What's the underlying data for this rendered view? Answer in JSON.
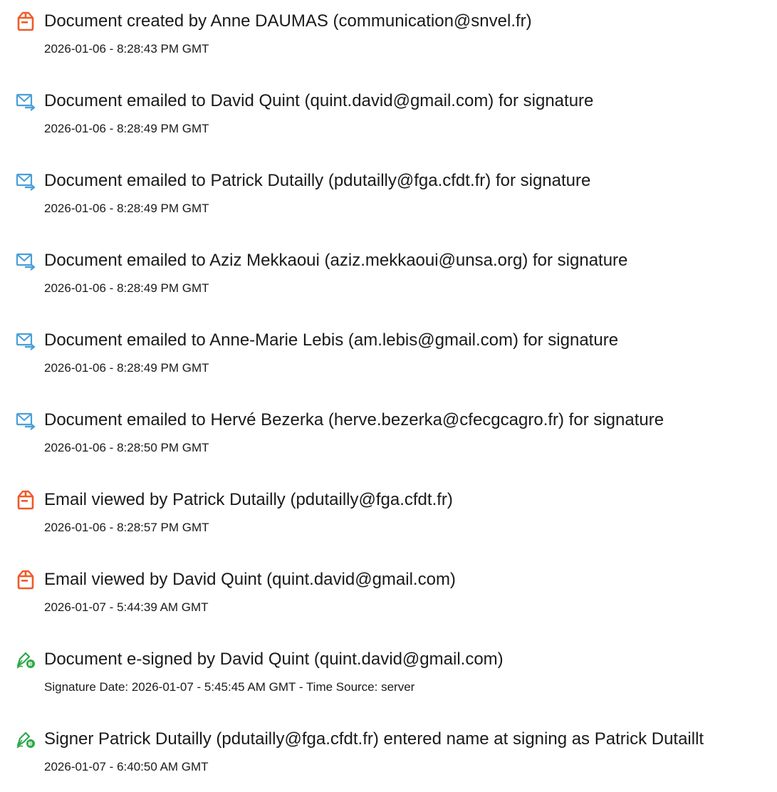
{
  "audit_log": {
    "entries": [
      {
        "icon": "document-created-icon",
        "title": "Document created by Anne DAUMAS (communication@snvel.fr)",
        "subtitle": "2026-01-06 - 8:28:43 PM GMT"
      },
      {
        "icon": "email-sent-icon",
        "title": "Document emailed to David Quint (quint.david@gmail.com) for signature",
        "subtitle": "2026-01-06 - 8:28:49 PM GMT"
      },
      {
        "icon": "email-sent-icon",
        "title": "Document emailed to Patrick Dutailly (pdutailly@fga.cfdt.fr) for signature",
        "subtitle": "2026-01-06 - 8:28:49 PM GMT"
      },
      {
        "icon": "email-sent-icon",
        "title": "Document emailed to Aziz Mekkaoui (aziz.mekkaoui@unsa.org) for signature",
        "subtitle": "2026-01-06 - 8:28:49 PM GMT"
      },
      {
        "icon": "email-sent-icon",
        "title": "Document emailed to Anne-Marie Lebis (am.lebis@gmail.com) for signature",
        "subtitle": "2026-01-06 - 8:28:49 PM GMT"
      },
      {
        "icon": "email-sent-icon",
        "title": "Document emailed to Hervé Bezerka (herve.bezerka@cfecgcagro.fr) for signature",
        "subtitle": "2026-01-06 - 8:28:50 PM GMT"
      },
      {
        "icon": "email-viewed-icon",
        "title": "Email viewed by Patrick Dutailly (pdutailly@fga.cfdt.fr)",
        "subtitle": "2026-01-06 - 8:28:57 PM GMT"
      },
      {
        "icon": "email-viewed-icon",
        "title": "Email viewed by David Quint (quint.david@gmail.com)",
        "subtitle": "2026-01-07 - 5:44:39 AM GMT"
      },
      {
        "icon": "e-signed-icon",
        "title": "Document e-signed by David Quint (quint.david@gmail.com)",
        "subtitle": "Signature Date: 2026-01-07 - 5:45:45 AM GMT - Time Source: server"
      },
      {
        "icon": "e-signed-icon",
        "title": "Signer Patrick Dutailly (pdutailly@fga.cfdt.fr) entered name at signing as Patrick Dutaillt",
        "subtitle": "2026-01-07 - 6:40:50 AM GMT"
      }
    ]
  },
  "colors": {
    "document_icon": "#f05a28",
    "email_icon": "#4a9fd8",
    "sign_icon": "#2ea84a",
    "text": "#1a1a1a"
  }
}
